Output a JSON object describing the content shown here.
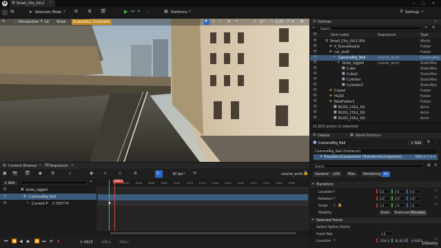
{
  "window": {
    "tab_title": "Small_City_LVL2",
    "window_controls": [
      "—",
      "▢",
      "✕"
    ]
  },
  "toolbar": {
    "select_mode": "Selection Mode",
    "platforms": "Platforms",
    "settings": "Settings"
  },
  "viewport": {
    "perspective": "Perspective",
    "lit": "Lit",
    "show": "Show",
    "scalability": "Scalability: Cinematic",
    "fov": "10°",
    "scale": "0.25",
    "count": "4"
  },
  "outliner": {
    "tab": "Outliner",
    "search_placeholder": "Search...",
    "col_label": "Item Label",
    "col_sequencer": "Sequencer",
    "col_type": "Type",
    "rows": [
      {
        "label": "Small_City_LVL2 (Ed",
        "seq": "",
        "type": "World"
      },
      {
        "label": "0_SceneAssets",
        "seq": "",
        "type": "Folder"
      },
      {
        "label": "car_stuff",
        "seq": "",
        "type": "Folder"
      },
      {
        "label": "CameraRig_Rail",
        "seq": "course_anim",
        "type": "CameraRig"
      },
      {
        "label": "brow_rigged",
        "seq": "course_anim",
        "type": "StaticMes"
      },
      {
        "label": "Cube",
        "seq": "",
        "type": "StaticMes"
      },
      {
        "label": "Cube2",
        "seq": "",
        "type": "StaticMes"
      },
      {
        "label": "Cylinder",
        "seq": "",
        "type": "StaticMes"
      },
      {
        "label": "Cylinder2",
        "seq": "",
        "type": "StaticMes"
      },
      {
        "label": "Crowd",
        "seq": "",
        "type": "Folder"
      },
      {
        "label": "HLOD",
        "seq": "",
        "type": "Folder"
      },
      {
        "label": "NewFolder1",
        "seq": "",
        "type": "Folder"
      },
      {
        "label": "BLDG_COLL_N1",
        "seq": "",
        "type": "Actor"
      },
      {
        "label": "BLDG_COLL_N1",
        "seq": "",
        "type": "Actor"
      },
      {
        "label": "BLDG_COLL_N1",
        "seq": "",
        "type": "Actor"
      }
    ],
    "status": "11,823 actors (1 selected)"
  },
  "details": {
    "tab1": "Details",
    "tab2": "World Partition",
    "actor_name": "CameraRig_Rail",
    "add": "+ Add",
    "instance": "CameraRig_Rail (Instance)",
    "component": "TransformComponent (TransformComponent)",
    "edit_cpp": "Edit in C++",
    "search_placeholder": "Search",
    "filters": [
      "General",
      "LOD",
      "Misc",
      "Rendering",
      "All"
    ],
    "transform_header": "Transform",
    "location_label": "Location",
    "location": [
      "0.0",
      "0.0",
      "0.0"
    ],
    "rotation_label": "Rotation",
    "rotation": [
      "0.0°",
      "0.0°",
      "0.0°"
    ],
    "scale_label": "Scale",
    "scale": [
      "1.0",
      "1.0",
      "1.0"
    ],
    "mobility_label": "Mobility",
    "mobility": [
      "Static",
      "Stationary",
      "Movable"
    ],
    "selected_points": "Selected Points",
    "select_spline": "Select Spline Points",
    "input_key_label": "Input Key",
    "input_key": "4.0",
    "location2_label": "Location",
    "location2": [
      "3294.0",
      "80.8033",
      "-0.00825"
    ]
  },
  "content": {
    "tab1": "Content Browser",
    "tab2": "Sequencer"
  },
  "sequencer": {
    "add": "+ Add",
    "fps": "30 fps",
    "sequence_name": "course_anim",
    "frame": "0023",
    "tracks": [
      {
        "name": "brow_rigged"
      },
      {
        "name": "CameraRig_Rail"
      },
      {
        "name": "Current P",
        "value": "0.398774"
      }
    ],
    "timecodes": [
      "-041+",
      "-041+"
    ],
    "end_frame": "0023",
    "ticks": [
      "0023",
      "0020",
      "0040",
      "0060",
      "0080",
      "0100",
      "0120",
      "0140",
      "0160",
      "0180",
      "0200",
      "0220",
      "0240",
      "0260",
      "0280"
    ]
  },
  "watermark": "Udemy"
}
